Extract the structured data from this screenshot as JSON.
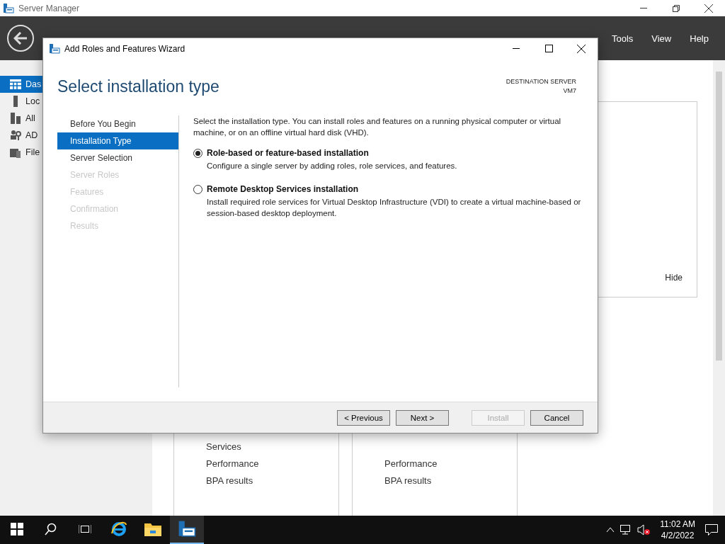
{
  "server_manager": {
    "title": "Server Manager",
    "menu": [
      "Tools",
      "View",
      "Help"
    ],
    "sidebar": [
      {
        "kind": "dashboard",
        "label": "Das",
        "selected": true
      },
      {
        "kind": "server",
        "label": "Loc",
        "selected": false
      },
      {
        "kind": "servers",
        "label": "All",
        "selected": false
      },
      {
        "kind": "ad",
        "label": "AD",
        "selected": false
      },
      {
        "kind": "files",
        "label": "File",
        "selected": false
      }
    ],
    "welcome_panel": {
      "hide_link": "Hide"
    },
    "tiles": [
      {
        "items": [
          "Services",
          "Performance",
          "BPA results"
        ]
      },
      {
        "items": [
          "Performance",
          "BPA results"
        ]
      }
    ]
  },
  "wizard": {
    "title": "Add Roles and Features Wizard",
    "heading": "Select installation type",
    "destination_label": "DESTINATION SERVER",
    "destination_value": "VM7",
    "steps": [
      {
        "label": "Before You Begin",
        "selected": false,
        "disabled": false
      },
      {
        "label": "Installation Type",
        "selected": true,
        "disabled": false
      },
      {
        "label": "Server Selection",
        "selected": false,
        "disabled": false
      },
      {
        "label": "Server Roles",
        "selected": false,
        "disabled": true
      },
      {
        "label": "Features",
        "selected": false,
        "disabled": true
      },
      {
        "label": "Confirmation",
        "selected": false,
        "disabled": true
      },
      {
        "label": "Results",
        "selected": false,
        "disabled": true
      }
    ],
    "intro": "Select the installation type. You can install roles and features on a running physical computer or virtual machine, or on an offline virtual hard disk (VHD).",
    "options": [
      {
        "label": "Role-based or feature-based installation",
        "description": "Configure a single server by adding roles, role services, and features.",
        "selected": true
      },
      {
        "label": "Remote Desktop Services installation",
        "description": "Install required role services for Virtual Desktop Infrastructure (VDI) to create a virtual machine-based or session-based desktop deployment.",
        "selected": false
      }
    ],
    "buttons": [
      {
        "label": "< Previous",
        "disabled": false
      },
      {
        "label": "Next >",
        "disabled": false
      },
      {
        "label": "Install",
        "disabled": true
      },
      {
        "label": "Cancel",
        "disabled": false
      }
    ]
  },
  "taskbar": {
    "apps": [
      {
        "kind": "browser",
        "active": false
      },
      {
        "kind": "folder",
        "active": false
      },
      {
        "kind": "server-manager",
        "active": true
      }
    ],
    "time": "11:02 AM",
    "date": "4/2/2022"
  }
}
